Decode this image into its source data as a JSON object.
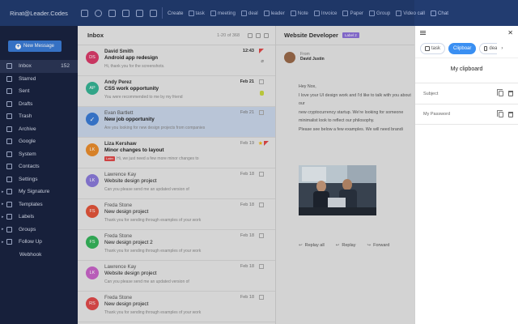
{
  "app": {
    "account": "Rinat@Leader.Codes"
  },
  "toolbar": {
    "create_label": "Create",
    "items": [
      {
        "label": "task",
        "icon": "task-icon"
      },
      {
        "label": "meeting",
        "icon": "meeting-icon"
      },
      {
        "label": "deal",
        "icon": "deal-icon"
      },
      {
        "label": "leader",
        "icon": "leader-icon"
      },
      {
        "label": "Note",
        "icon": "note-icon"
      },
      {
        "label": "Invoice",
        "icon": "invoice-icon"
      },
      {
        "label": "Paper",
        "icon": "paper-icon"
      },
      {
        "label": "Group",
        "icon": "group-icon"
      },
      {
        "label": "Video call",
        "icon": "video-call-icon"
      },
      {
        "label": "Chat",
        "icon": "chat-icon"
      }
    ]
  },
  "sidebar": {
    "new_message_label": "New Message",
    "items": [
      {
        "label": "Inbox",
        "count": "152",
        "icon": "inbox-icon"
      },
      {
        "label": "Starred",
        "icon": "star-icon"
      },
      {
        "label": "Sent",
        "icon": "send-icon"
      },
      {
        "label": "Drafts",
        "icon": "draft-icon"
      },
      {
        "label": "Trash",
        "icon": "trash-icon"
      },
      {
        "label": "Archive",
        "icon": "archive-icon"
      },
      {
        "label": "Google",
        "icon": "google-icon"
      },
      {
        "label": "System",
        "icon": "system-icon"
      },
      {
        "label": "Contacts",
        "icon": "contacts-icon"
      },
      {
        "label": "Settings",
        "icon": "settings-icon"
      },
      {
        "label": "My Signature",
        "icon": "signature-icon"
      },
      {
        "label": "Templates",
        "icon": "templates-icon"
      },
      {
        "label": "Labels",
        "icon": "labels-icon"
      },
      {
        "label": "Groups",
        "icon": "groups-icon"
      },
      {
        "label": "Follow Up",
        "icon": "follow-up-icon"
      },
      {
        "label": "Webhook",
        "icon": "webhook-icon"
      }
    ]
  },
  "inbox": {
    "title": "Inbox",
    "range": "1-20 of 368",
    "messages": [
      {
        "initials": "DS",
        "color": "#d93b6a",
        "from": "David Smith",
        "subject": "Android app redesign",
        "preview": "Hi, thank you for the screenshots.",
        "date": "12:43"
      },
      {
        "initials": "AP",
        "color": "#37b394",
        "from": "Andy Perez",
        "subject": "CSS work opportunity",
        "preview": "You were recommended to me by my friend",
        "date": "Feb 21"
      },
      {
        "initials": "",
        "color": "#3a7bd5",
        "from": "Evan Bartlett",
        "subject": "New job opportunity",
        "preview": "Are you looking for new design projects from companies",
        "date": "Feb 21"
      },
      {
        "initials": "LK",
        "color": "#ea8c2c",
        "from": "Liza Kershaw",
        "subject": "Minor changes to layout",
        "preview": "Hi, we just need a few more minor changes to",
        "tag": "Later",
        "date": "Feb 19"
      },
      {
        "initials": "LK",
        "color": "#8a7ad9",
        "from": "Lawrence Kay",
        "subject": "Website design project",
        "preview": "Can you please send me an updated version of",
        "date": "Feb 18"
      },
      {
        "initials": "FS",
        "color": "#e2543a",
        "from": "Freda Stone",
        "subject": "New design project",
        "preview": "Thank you for sending through examples of your work",
        "date": "Feb 18"
      },
      {
        "initials": "FS",
        "color": "#35b35b",
        "from": "Freda Stone",
        "subject": "New design project 2",
        "preview": "Thank you for sending through examples of your work",
        "date": "Feb 18"
      },
      {
        "initials": "LK",
        "color": "#c864c8",
        "from": "Lawrence Kay",
        "subject": "Website design project",
        "preview": "Can you please send me an updated version of",
        "date": "Feb 18"
      },
      {
        "initials": "RS",
        "color": "#e04a4a",
        "from": "Freda Stone",
        "subject": "New design project",
        "preview": "Thank you for sending through examples of your work",
        "date": "Feb 18"
      }
    ]
  },
  "reader": {
    "title": "Website Developer",
    "label": "Label 2",
    "from_label": "From",
    "from_name": "David Justin",
    "body": [
      "Hey Nox,",
      "I love your UI design work and I'd like to talk with you about",
      "our",
      "new cryptocurrency startup. We're looking for someone",
      "minimalist look to reflect our philosophy.",
      "Please see below a few examples. We will need brandi"
    ],
    "reply_all": "Replay all",
    "reply": "Replay",
    "forward": "Forward"
  },
  "clipboard": {
    "tabs": [
      "task",
      "Clipboar",
      "dea"
    ],
    "title": "My clipboard",
    "rows": [
      {
        "label": "Subject"
      },
      {
        "label": "My Password"
      }
    ]
  }
}
